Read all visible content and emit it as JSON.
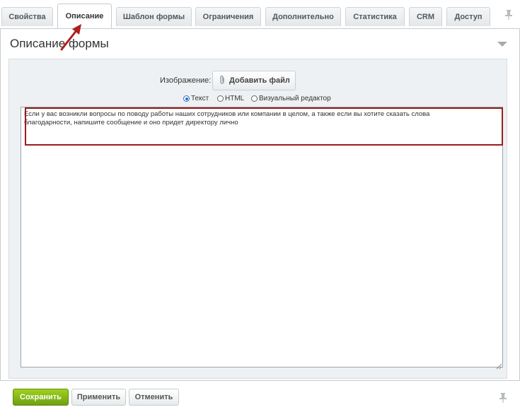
{
  "tabs": [
    {
      "label": "Свойства"
    },
    {
      "label": "Описание"
    },
    {
      "label": "Шаблон формы"
    },
    {
      "label": "Ограничения"
    },
    {
      "label": "Дополнительно"
    },
    {
      "label": "Статистика"
    },
    {
      "label": "CRM"
    },
    {
      "label": "Доступ"
    }
  ],
  "active_tab": "Описание",
  "section": {
    "title": "Описание формы"
  },
  "image": {
    "label": "Изображение:",
    "add_file_label": "Добавить файл"
  },
  "editor_modes": {
    "options": [
      "Текст",
      "HTML",
      "Визуальный редактор"
    ],
    "selected": "Текст"
  },
  "description": {
    "line1": "Если у вас возникли вопросы по поводу работы наших сотрудников или компании в целом, а также если вы хотите сказать слова",
    "line2": "благодарности, напишите сообщение и оно придет директору лично"
  },
  "footer": {
    "save_label": "Сохранить",
    "apply_label": "Применить",
    "cancel_label": "Отменить"
  },
  "colors": {
    "accent_green": "#7db214",
    "highlight_red": "#9b1c1c",
    "selected_radio": "#2a6fc9"
  },
  "icons": [
    "pin-icon",
    "paperclip-icon",
    "collapse-triangle-icon",
    "resize-grip-icon",
    "annotation-arrow-icon"
  ]
}
